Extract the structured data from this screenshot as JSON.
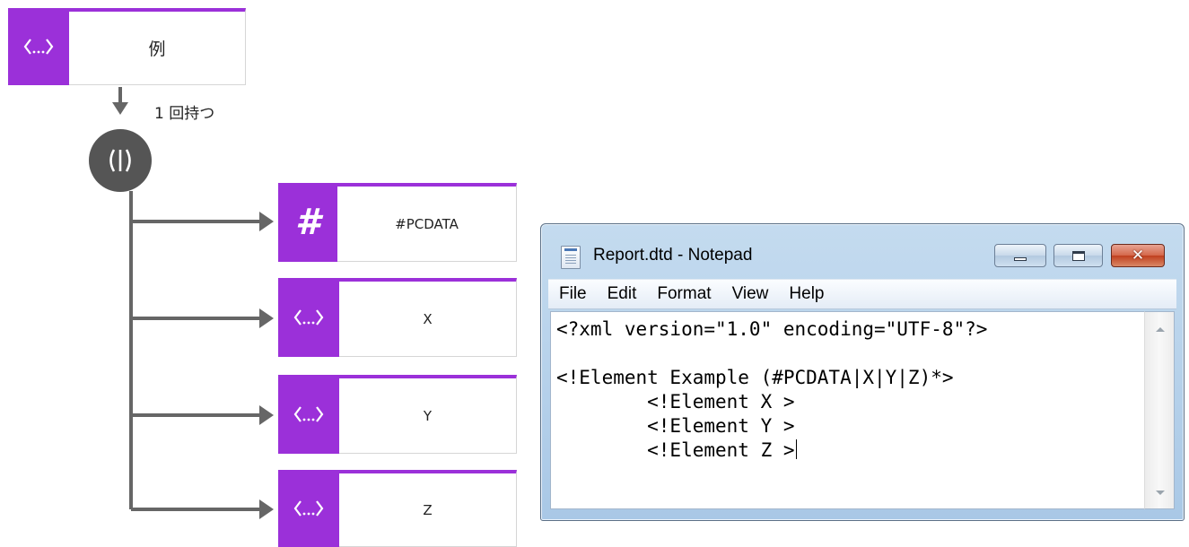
{
  "diagram": {
    "root": {
      "label": "例",
      "icon": "element-icon"
    },
    "occurrence_label": "1 回持つ",
    "choice": {
      "icon": "choice-icon"
    },
    "children": [
      {
        "label": "#PCDATA",
        "icon": "hash-icon"
      },
      {
        "label": "X",
        "icon": "element-icon"
      },
      {
        "label": "Y",
        "icon": "element-icon"
      },
      {
        "label": "Z",
        "icon": "element-icon"
      }
    ],
    "colors": {
      "accent": "#9b30d9",
      "connector": "#666666",
      "choice_fill": "#555555"
    }
  },
  "notepad": {
    "title": "Report.dtd - Notepad",
    "menu": [
      "File",
      "Edit",
      "Format",
      "View",
      "Help"
    ],
    "lines": [
      "<?xml version=\"1.0\" encoding=\"UTF-8\"?>",
      "",
      "<!Element Example (#PCDATA|X|Y|Z)*>",
      "        <!Element X >",
      "        <!Element Y >",
      "        <!Element Z >"
    ]
  }
}
